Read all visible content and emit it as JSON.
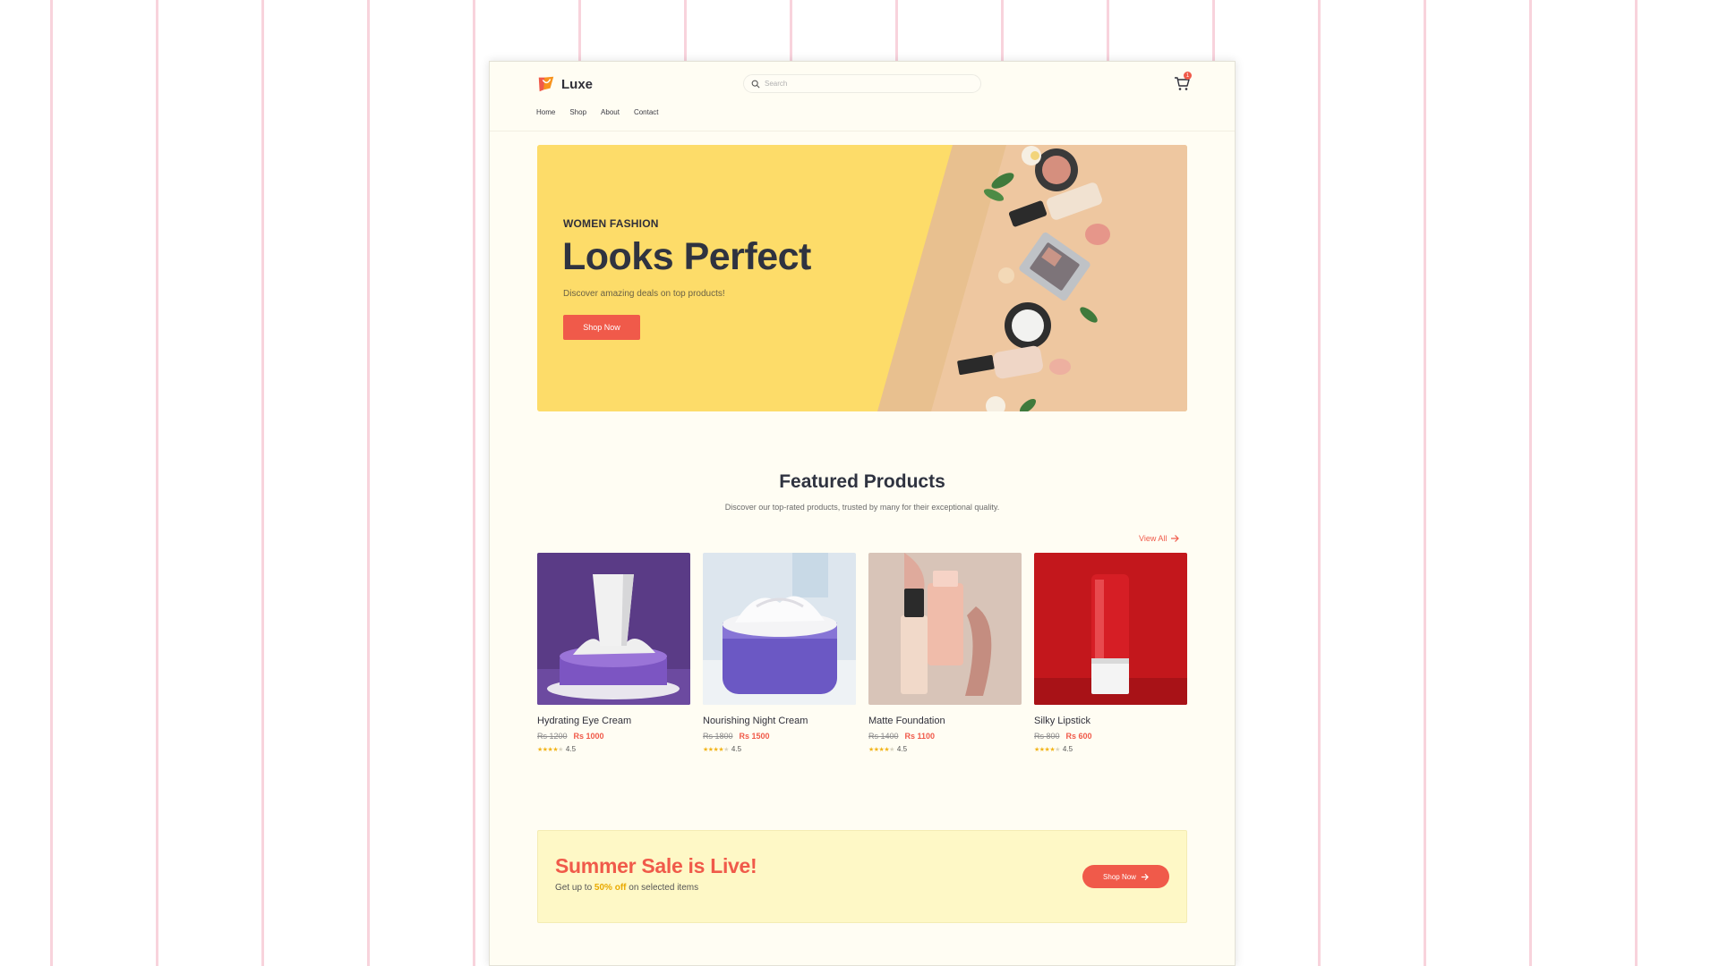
{
  "header": {
    "brand": "Luxe",
    "search_placeholder": "Search",
    "cart_count": "1",
    "nav": [
      "Home",
      "Shop",
      "About",
      "Contact"
    ]
  },
  "hero": {
    "eyebrow": "WOMEN FASHION",
    "title": "Looks Perfect",
    "subtitle": "Discover amazing deals on top products!",
    "button": "Shop Now"
  },
  "featured": {
    "title": "Featured Products",
    "subtitle": "Discover our top-rated products, trusted by many for their exceptional quality.",
    "view_all": "View All",
    "products": [
      {
        "name": "Hydrating Eye Cream",
        "old_price": "Rs 1200",
        "price": "Rs 1000",
        "rating": "4.5"
      },
      {
        "name": "Nourishing Night Cream",
        "old_price": "Rs 1800",
        "price": "Rs 1500",
        "rating": "4.5"
      },
      {
        "name": "Matte Foundation",
        "old_price": "Rs 1400",
        "price": "Rs 1100",
        "rating": "4.5"
      },
      {
        "name": "Silky Lipstick",
        "old_price": "Rs 800",
        "price": "Rs 600",
        "rating": "4.5"
      }
    ]
  },
  "sale": {
    "title": "Summer Sale is Live!",
    "text_before": "Get up to ",
    "highlight": "50% off",
    "text_after": " on selected items",
    "button": "Shop Now"
  },
  "colors": {
    "accent": "#f05a4a",
    "hero_yellow": "#fddc69",
    "page_bg": "#fffdf3",
    "sale_bg": "#fef8c6",
    "star": "#f2b51b"
  },
  "icons": [
    "logo-mark-icon",
    "search-icon",
    "cart-icon",
    "arrow-right-icon",
    "star-icon"
  ]
}
